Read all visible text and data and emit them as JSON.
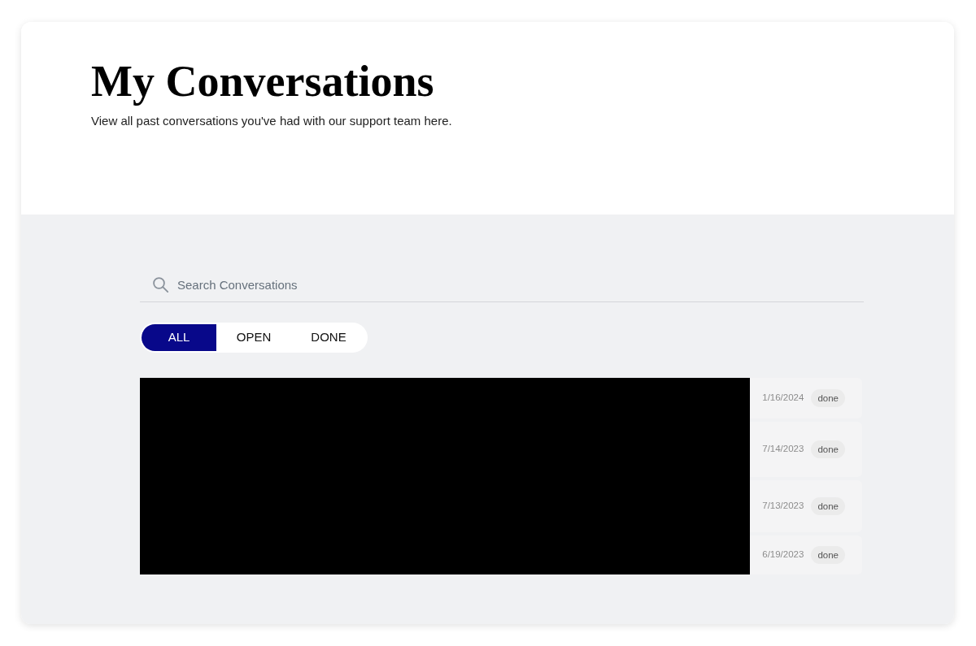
{
  "header": {
    "title": "My Conversations",
    "subtitle": "View all past conversations you've had with our support team here."
  },
  "search": {
    "placeholder": "Search Conversations"
  },
  "filter_tabs": [
    {
      "label": "ALL",
      "selected": true
    },
    {
      "label": "OPEN",
      "selected": false
    },
    {
      "label": "DONE",
      "selected": false
    }
  ],
  "conversations": [
    {
      "date": "1/16/2024",
      "status": "done"
    },
    {
      "date": "7/14/2023",
      "status": "done"
    },
    {
      "date": "7/13/2023",
      "status": "done"
    },
    {
      "date": "6/19/2023",
      "status": "done"
    }
  ]
}
